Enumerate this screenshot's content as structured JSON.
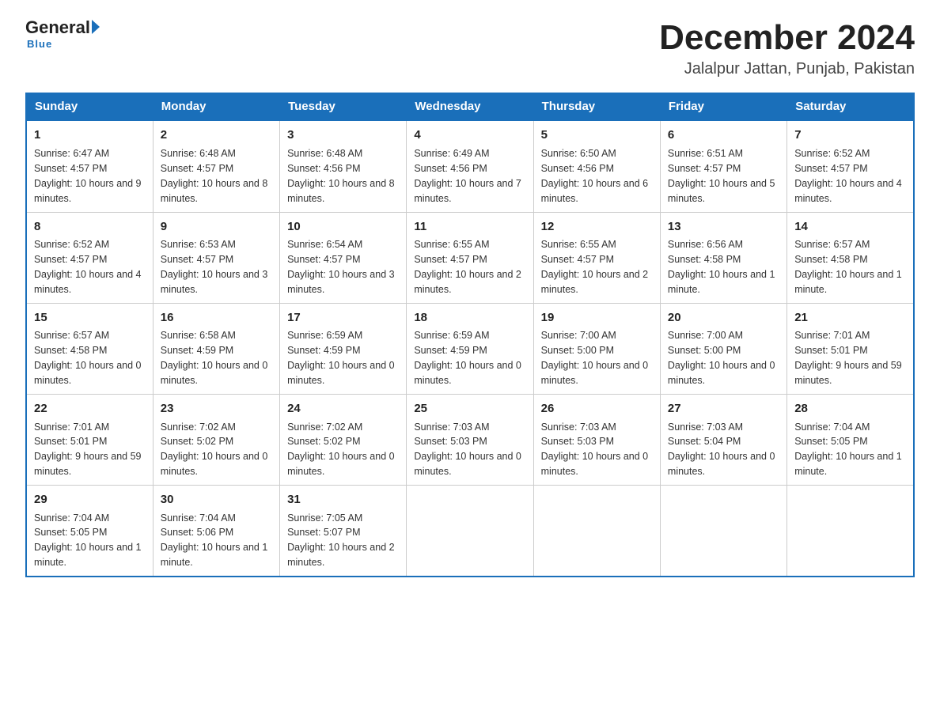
{
  "header": {
    "logo_general": "General",
    "logo_blue": "Blue",
    "main_title": "December 2024",
    "subtitle": "Jalalpur Jattan, Punjab, Pakistan"
  },
  "calendar": {
    "days_of_week": [
      "Sunday",
      "Monday",
      "Tuesday",
      "Wednesday",
      "Thursday",
      "Friday",
      "Saturday"
    ],
    "weeks": [
      [
        {
          "day": "1",
          "sunrise": "6:47 AM",
          "sunset": "4:57 PM",
          "daylight": "10 hours and 9 minutes."
        },
        {
          "day": "2",
          "sunrise": "6:48 AM",
          "sunset": "4:57 PM",
          "daylight": "10 hours and 8 minutes."
        },
        {
          "day": "3",
          "sunrise": "6:48 AM",
          "sunset": "4:56 PM",
          "daylight": "10 hours and 8 minutes."
        },
        {
          "day": "4",
          "sunrise": "6:49 AM",
          "sunset": "4:56 PM",
          "daylight": "10 hours and 7 minutes."
        },
        {
          "day": "5",
          "sunrise": "6:50 AM",
          "sunset": "4:56 PM",
          "daylight": "10 hours and 6 minutes."
        },
        {
          "day": "6",
          "sunrise": "6:51 AM",
          "sunset": "4:57 PM",
          "daylight": "10 hours and 5 minutes."
        },
        {
          "day": "7",
          "sunrise": "6:52 AM",
          "sunset": "4:57 PM",
          "daylight": "10 hours and 4 minutes."
        }
      ],
      [
        {
          "day": "8",
          "sunrise": "6:52 AM",
          "sunset": "4:57 PM",
          "daylight": "10 hours and 4 minutes."
        },
        {
          "day": "9",
          "sunrise": "6:53 AM",
          "sunset": "4:57 PM",
          "daylight": "10 hours and 3 minutes."
        },
        {
          "day": "10",
          "sunrise": "6:54 AM",
          "sunset": "4:57 PM",
          "daylight": "10 hours and 3 minutes."
        },
        {
          "day": "11",
          "sunrise": "6:55 AM",
          "sunset": "4:57 PM",
          "daylight": "10 hours and 2 minutes."
        },
        {
          "day": "12",
          "sunrise": "6:55 AM",
          "sunset": "4:57 PM",
          "daylight": "10 hours and 2 minutes."
        },
        {
          "day": "13",
          "sunrise": "6:56 AM",
          "sunset": "4:58 PM",
          "daylight": "10 hours and 1 minute."
        },
        {
          "day": "14",
          "sunrise": "6:57 AM",
          "sunset": "4:58 PM",
          "daylight": "10 hours and 1 minute."
        }
      ],
      [
        {
          "day": "15",
          "sunrise": "6:57 AM",
          "sunset": "4:58 PM",
          "daylight": "10 hours and 0 minutes."
        },
        {
          "day": "16",
          "sunrise": "6:58 AM",
          "sunset": "4:59 PM",
          "daylight": "10 hours and 0 minutes."
        },
        {
          "day": "17",
          "sunrise": "6:59 AM",
          "sunset": "4:59 PM",
          "daylight": "10 hours and 0 minutes."
        },
        {
          "day": "18",
          "sunrise": "6:59 AM",
          "sunset": "4:59 PM",
          "daylight": "10 hours and 0 minutes."
        },
        {
          "day": "19",
          "sunrise": "7:00 AM",
          "sunset": "5:00 PM",
          "daylight": "10 hours and 0 minutes."
        },
        {
          "day": "20",
          "sunrise": "7:00 AM",
          "sunset": "5:00 PM",
          "daylight": "10 hours and 0 minutes."
        },
        {
          "day": "21",
          "sunrise": "7:01 AM",
          "sunset": "5:01 PM",
          "daylight": "9 hours and 59 minutes."
        }
      ],
      [
        {
          "day": "22",
          "sunrise": "7:01 AM",
          "sunset": "5:01 PM",
          "daylight": "9 hours and 59 minutes."
        },
        {
          "day": "23",
          "sunrise": "7:02 AM",
          "sunset": "5:02 PM",
          "daylight": "10 hours and 0 minutes."
        },
        {
          "day": "24",
          "sunrise": "7:02 AM",
          "sunset": "5:02 PM",
          "daylight": "10 hours and 0 minutes."
        },
        {
          "day": "25",
          "sunrise": "7:03 AM",
          "sunset": "5:03 PM",
          "daylight": "10 hours and 0 minutes."
        },
        {
          "day": "26",
          "sunrise": "7:03 AM",
          "sunset": "5:03 PM",
          "daylight": "10 hours and 0 minutes."
        },
        {
          "day": "27",
          "sunrise": "7:03 AM",
          "sunset": "5:04 PM",
          "daylight": "10 hours and 0 minutes."
        },
        {
          "day": "28",
          "sunrise": "7:04 AM",
          "sunset": "5:05 PM",
          "daylight": "10 hours and 1 minute."
        }
      ],
      [
        {
          "day": "29",
          "sunrise": "7:04 AM",
          "sunset": "5:05 PM",
          "daylight": "10 hours and 1 minute."
        },
        {
          "day": "30",
          "sunrise": "7:04 AM",
          "sunset": "5:06 PM",
          "daylight": "10 hours and 1 minute."
        },
        {
          "day": "31",
          "sunrise": "7:05 AM",
          "sunset": "5:07 PM",
          "daylight": "10 hours and 2 minutes."
        },
        null,
        null,
        null,
        null
      ]
    ]
  }
}
